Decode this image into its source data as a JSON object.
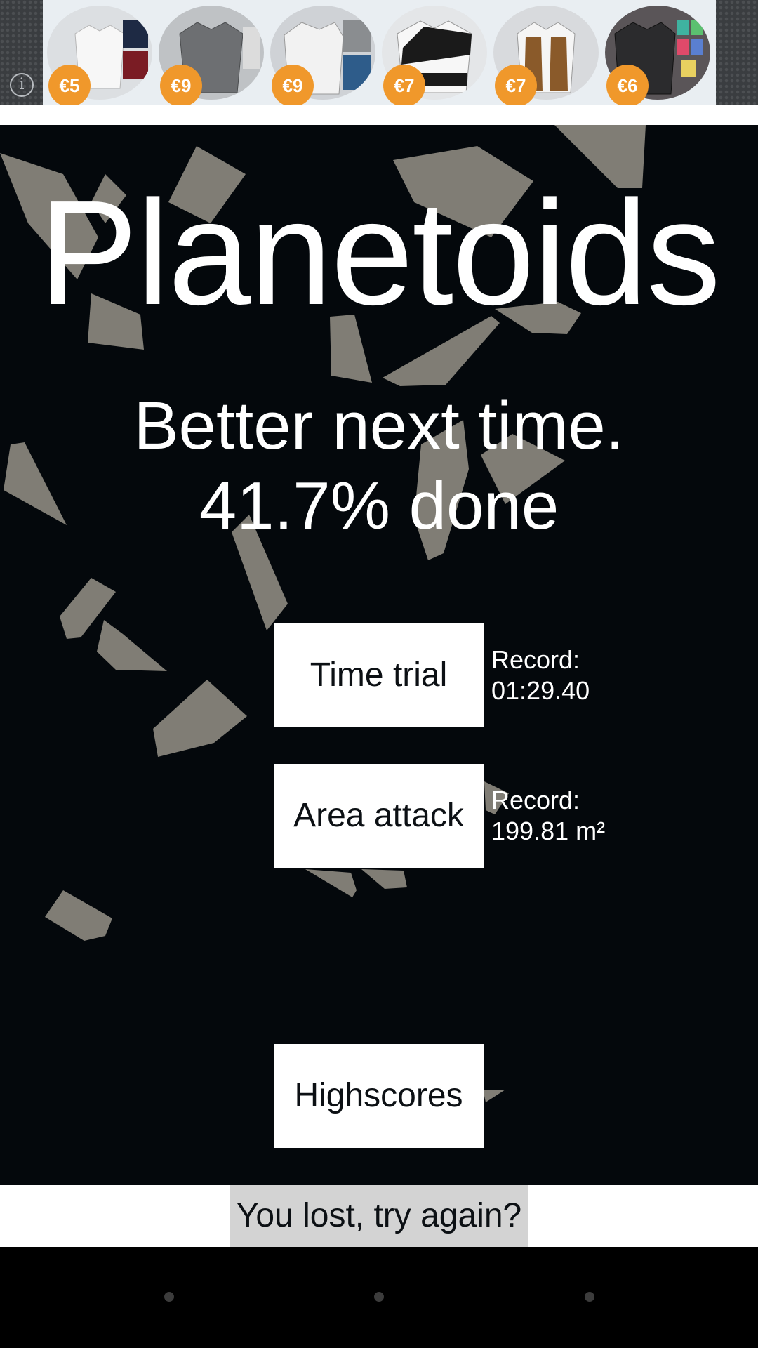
{
  "ad": {
    "info_icon": "info-icon",
    "items": [
      {
        "price": "€5",
        "product": "white polo shirt"
      },
      {
        "price": "€9",
        "product": "grey dress shirt"
      },
      {
        "price": "€9",
        "product": "white zip hoodie"
      },
      {
        "price": "€7",
        "product": "black and white polo"
      },
      {
        "price": "€7",
        "product": "brown vest shirt"
      },
      {
        "price": "€6",
        "product": "dark v-neck tee"
      }
    ]
  },
  "game": {
    "title": "Planetoids",
    "message_line1": "Better next time.",
    "message_line2": "41.7% done",
    "progress_percent": 41.7,
    "modes": [
      {
        "label": "Time trial",
        "record_label": "Record:",
        "record_value": "01:29.40"
      },
      {
        "label": "Area attack",
        "record_label": "Record:",
        "record_value": "199.81 m²"
      }
    ],
    "highscores_label": "Highscores",
    "retry_label": "You lost, try again?"
  },
  "colors": {
    "background": "#04080c",
    "asteroid": "#807d75",
    "button": "#ffffff",
    "retry_bg": "#d3d3d3",
    "price_badge": "#f0982b"
  }
}
